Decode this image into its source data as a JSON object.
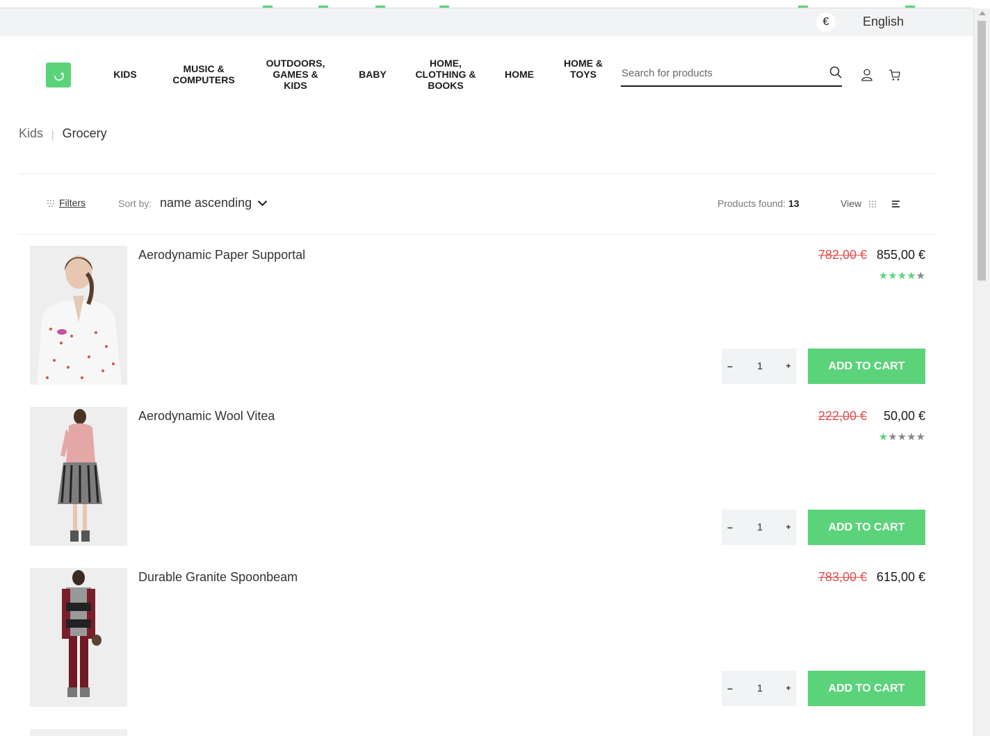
{
  "topbar": {
    "currency_symbol": "€",
    "language": "English"
  },
  "nav": {
    "items": [
      {
        "label": "KIDS"
      },
      {
        "label": "MUSIC & COMPUTERS"
      },
      {
        "label": "OUTDOORS, GAMES & KIDS"
      },
      {
        "label": "BABY"
      },
      {
        "label": "HOME, CLOTHING & BOOKS"
      },
      {
        "label": "HOME"
      },
      {
        "label": "HOME & TOYS"
      }
    ]
  },
  "search": {
    "placeholder": "Search for products",
    "value": ""
  },
  "breadcrumb": {
    "parent": "Kids",
    "current": "Grocery"
  },
  "toolbar": {
    "filters_label": "Filters",
    "sort_label": "Sort by:",
    "sort_value": "name ascending",
    "products_found_label": "Products found:",
    "products_found_count": "13",
    "view_label": "View"
  },
  "products": [
    {
      "name": "Aerodynamic Paper Supportal",
      "old_price": "782,00 €",
      "price": "855,00 €",
      "rating": 4,
      "qty": "1",
      "add_label": "ADD TO CART"
    },
    {
      "name": "Aerodynamic Wool Vitea",
      "old_price": "222,00 €",
      "price": "50,00 €",
      "rating": 1,
      "qty": "1",
      "add_label": "ADD TO CART"
    },
    {
      "name": "Durable Granite Spoonbeam",
      "old_price": "783,00 €",
      "price": "615,00 €",
      "rating": 0,
      "qty": "1",
      "add_label": "ADD TO CART"
    }
  ],
  "colors": {
    "accent": "#5bd37a",
    "old_price": "#e24c4c"
  }
}
